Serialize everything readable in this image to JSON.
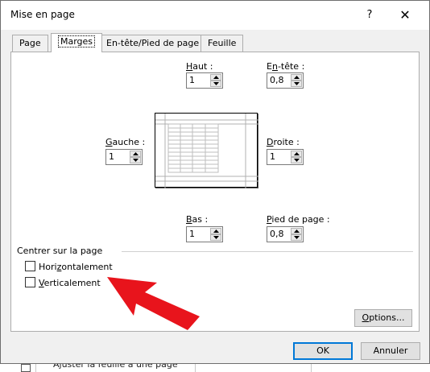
{
  "window": {
    "title": "Mise en page",
    "help_label": "?",
    "close_label": "✕"
  },
  "tabs": [
    {
      "label": "Page",
      "active": false
    },
    {
      "label": "Marges",
      "active": true
    },
    {
      "label": "En-tête/Pied de page",
      "active": false
    },
    {
      "label": "Feuille",
      "active": false
    }
  ],
  "margins": {
    "haut": {
      "label_pre": "",
      "label_u": "H",
      "label_post": "aut :",
      "value": "1"
    },
    "entete": {
      "label_pre": "E",
      "label_u": "n",
      "label_post": "-tête :",
      "value": "0,8"
    },
    "gauche": {
      "label_pre": "",
      "label_u": "G",
      "label_post": "auche :",
      "value": "1"
    },
    "droite": {
      "label_pre": "",
      "label_u": "D",
      "label_post": "roite :",
      "value": "1"
    },
    "bas": {
      "label_pre": "",
      "label_u": "B",
      "label_post": "as :",
      "value": "1"
    },
    "pied": {
      "label_pre": "",
      "label_u": "P",
      "label_post": "ied de page :",
      "value": "0,8"
    }
  },
  "center": {
    "group_title": "Centrer sur la page",
    "horizontal": {
      "label_pre": "Hori",
      "label_u": "z",
      "label_post": "ontalement",
      "checked": false
    },
    "vertical": {
      "label_pre": "",
      "label_u": "V",
      "label_post": "erticalement",
      "checked": false
    }
  },
  "buttons": {
    "options_u": "O",
    "options_post": "ptions...",
    "ok": "OK",
    "cancel": "Annuler"
  },
  "background": {
    "partial_text": "Ajuster la feuille à une page"
  },
  "colors": {
    "annotation_arrow": "#e8141c",
    "default_button_border": "#0078d7"
  }
}
